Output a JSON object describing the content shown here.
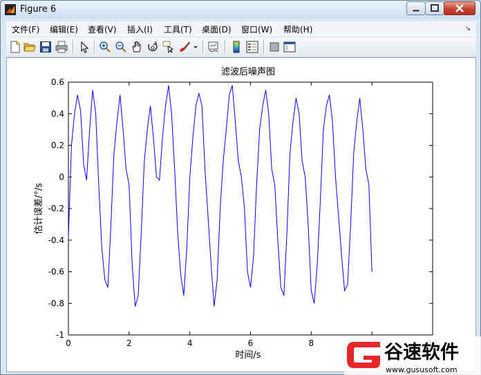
{
  "window": {
    "title": "Figure 6"
  },
  "menu": {
    "items": [
      {
        "label": "文件(F)"
      },
      {
        "label": "编辑(E)"
      },
      {
        "label": "查看(V)"
      },
      {
        "label": "插入(I)"
      },
      {
        "label": "工具(T)"
      },
      {
        "label": "桌面(D)"
      },
      {
        "label": "窗口(W)"
      },
      {
        "label": "帮助(H)"
      }
    ]
  },
  "toolbar": {
    "buttons": [
      {
        "icon": "new-figure-icon"
      },
      {
        "icon": "open-file-icon"
      },
      {
        "icon": "save-icon"
      },
      {
        "icon": "print-icon"
      },
      {
        "icon": "edit-plot-arrow-icon"
      },
      {
        "icon": "zoom-in-icon"
      },
      {
        "icon": "zoom-out-icon"
      },
      {
        "icon": "pan-hand-icon"
      },
      {
        "icon": "rotate-3d-icon"
      },
      {
        "icon": "data-cursor-icon"
      },
      {
        "icon": "brush-icon"
      },
      {
        "icon": "link-plot-icon"
      },
      {
        "icon": "colorbar-icon"
      },
      {
        "icon": "legend-icon"
      },
      {
        "icon": "hide-plot-tools-icon"
      },
      {
        "icon": "show-plot-tools-icon"
      }
    ]
  },
  "watermark": {
    "text": "谷速软件",
    "url": "www.gususoft.com",
    "accent": "#e8262a"
  },
  "chart_data": {
    "type": "line",
    "title": "滤波后噪声图",
    "xlabel": "时间/s",
    "ylabel": "估计误差/°/s",
    "xlim": [
      0,
      12
    ],
    "ylim": [
      -1,
      0.6
    ],
    "xticks": [
      "0",
      "2",
      "4",
      "6",
      "8",
      "10",
      "12"
    ],
    "yticks": [
      "-1",
      "-0.8",
      "-0.6",
      "-0.4",
      "-0.2",
      "0",
      "0.2",
      "0.4",
      "0.6"
    ],
    "grid": false,
    "color": "#0000ff",
    "series": [
      {
        "x": [
          0.0,
          0.1,
          0.2,
          0.3,
          0.4,
          0.5,
          0.6,
          0.7,
          0.8,
          0.9,
          1.0,
          1.1,
          1.2,
          1.3,
          1.4,
          1.5,
          1.6,
          1.7,
          1.8,
          1.9,
          2.0,
          2.1,
          2.2,
          2.3,
          2.4,
          2.5,
          2.6,
          2.7,
          2.8,
          2.9,
          3.0,
          3.1,
          3.2,
          3.3,
          3.4,
          3.5,
          3.6,
          3.7,
          3.8,
          3.9,
          4.0,
          4.1,
          4.2,
          4.3,
          4.4,
          4.5,
          4.6,
          4.7,
          4.8,
          4.9,
          5.0,
          5.1,
          5.2,
          5.3,
          5.4,
          5.5,
          5.6,
          5.7,
          5.8,
          5.9,
          6.0,
          6.1,
          6.2,
          6.3,
          6.4,
          6.5,
          6.6,
          6.7,
          6.8,
          6.9,
          7.0,
          7.1,
          7.2,
          7.3,
          7.4,
          7.5,
          7.6,
          7.7,
          7.8,
          7.9,
          8.0,
          8.1,
          8.2,
          8.3,
          8.4,
          8.5,
          8.6,
          8.7,
          8.8,
          8.9,
          9.0,
          9.1,
          9.2,
          9.3,
          9.4,
          9.5,
          9.6,
          9.7,
          9.8,
          9.9,
          10.0
        ],
        "y": [
          -0.38,
          0.2,
          0.4,
          0.52,
          0.42,
          0.08,
          -0.02,
          0.3,
          0.55,
          0.4,
          -0.05,
          -0.45,
          -0.65,
          -0.7,
          -0.3,
          0.15,
          0.35,
          0.52,
          0.3,
          0.05,
          -0.05,
          -0.55,
          -0.82,
          -0.75,
          -0.35,
          0.1,
          0.3,
          0.45,
          0.25,
          0.0,
          -0.02,
          0.25,
          0.45,
          0.58,
          0.4,
          0.05,
          -0.35,
          -0.62,
          -0.75,
          -0.45,
          0.0,
          0.25,
          0.45,
          0.53,
          0.45,
          0.05,
          -0.25,
          -0.55,
          -0.82,
          -0.65,
          -0.2,
          0.1,
          0.3,
          0.52,
          0.58,
          0.35,
          0.1,
          0.0,
          -0.2,
          -0.6,
          -0.7,
          -0.5,
          -0.05,
          0.3,
          0.45,
          0.55,
          0.4,
          0.05,
          -0.05,
          -0.4,
          -0.7,
          -0.75,
          -0.35,
          0.15,
          0.35,
          0.5,
          0.4,
          0.1,
          0.0,
          -0.3,
          -0.72,
          -0.8,
          -0.55,
          -0.15,
          0.3,
          0.45,
          0.52,
          0.35,
          0.0,
          -0.25,
          -0.5,
          -0.72,
          -0.68,
          -0.3,
          0.15,
          0.35,
          0.5,
          0.3,
          0.05,
          -0.05,
          -0.6
        ]
      }
    ]
  }
}
